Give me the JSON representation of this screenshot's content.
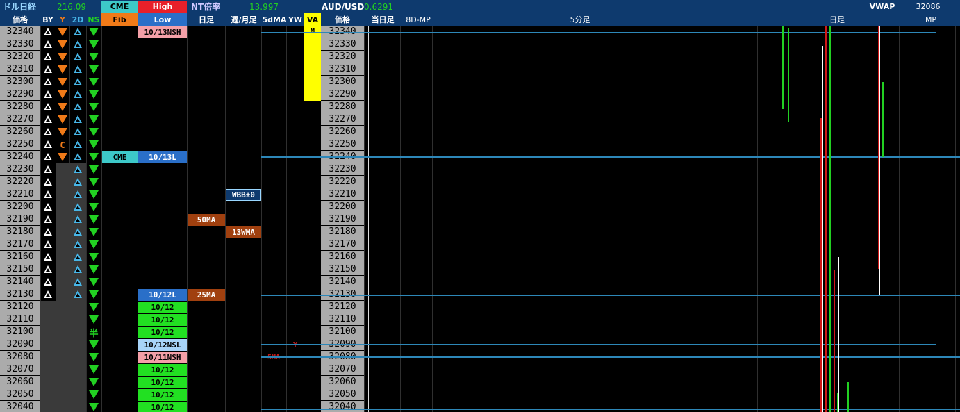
{
  "header": {
    "pair_label": "ドル日経",
    "pair_value": "216.09",
    "cme_label": "CME",
    "high_label": "High",
    "nt_label": "NT倍率",
    "nt_value": "13.997",
    "audusd_label": "AUD/USD",
    "audusd_value": "0.6291",
    "vwap_label": "VWAP",
    "vwap_value": "32086"
  },
  "subheader": {
    "price": "価格",
    "by": "BY",
    "y": "Y",
    "d2": "2D",
    "ns": "NS",
    "fib": "Fib",
    "low": "Low",
    "daily": "日足",
    "weekly_monthly": "週/月足",
    "ma5d": "5dMA",
    "yw": "YW",
    "va": "VA",
    "price2": "価格",
    "today": "当日足",
    "mp8d": "8D-MP",
    "min5": "5分足",
    "daily2": "日足",
    "mp": "MP"
  },
  "prices": [
    "32340",
    "32330",
    "32320",
    "32310",
    "32300",
    "32290",
    "32280",
    "32270",
    "32260",
    "32250",
    "32240",
    "32230",
    "32220",
    "32210",
    "32200",
    "32190",
    "32180",
    "32170",
    "32160",
    "32150",
    "32140",
    "32130",
    "32120",
    "32110",
    "32100",
    "32090",
    "32080",
    "32070",
    "32060",
    "32050",
    "32040"
  ],
  "tags": {
    "low_1013nsh": "10/13NSH",
    "cme_tag": "CME",
    "low_1013l": "10/13L",
    "wbb": "WBB±0",
    "ma50": "50MA",
    "wma13": "13WMA",
    "low_1012l": "10/12L",
    "ma25": "25MA",
    "d1012": "10/12",
    "nsl_1012": "10/12NSL",
    "nsh_1011": "10/11NSH",
    "c_mark": "C",
    "half_mark": "半",
    "y_mark": "Y",
    "ma5_mark": "5MA",
    "va_mark": "M"
  },
  "colors": {
    "header_bg": "#0e3a6e",
    "price_bg": "#ababab",
    "green": "#22d022",
    "orange": "#f07a18",
    "blue_line": "#2d87b8",
    "yellow": "#ffff00",
    "brown": "#a0400f"
  }
}
